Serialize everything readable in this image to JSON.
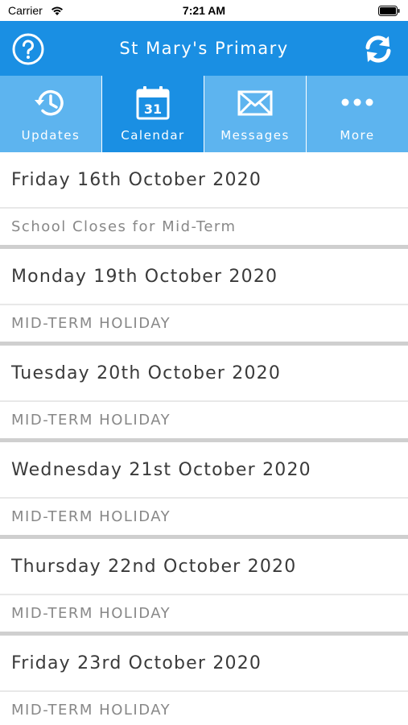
{
  "status_bar": {
    "carrier": "Carrier",
    "time": "7:21 AM"
  },
  "header": {
    "title": "St Mary's Primary",
    "help_icon": "question-circle-icon",
    "refresh_icon": "refresh-icon"
  },
  "colors": {
    "primary": "#1a8fe3",
    "tab_inactive": "#5db4ef",
    "divider": "#cfcfcf",
    "date_text": "#3a3a3a",
    "event_text": "#888888"
  },
  "tabs": [
    {
      "label": "Updates",
      "icon": "history-clock-icon",
      "active": false
    },
    {
      "label": "Calendar",
      "icon": "calendar-icon",
      "icon_text": "31",
      "active": true
    },
    {
      "label": "Messages",
      "icon": "envelope-icon",
      "active": false
    },
    {
      "label": "More",
      "icon": "ellipsis-icon",
      "active": false
    }
  ],
  "events": [
    {
      "date": "Friday 16th October 2020",
      "title": "School Closes for Mid-Term"
    },
    {
      "date": "Monday 19th October 2020",
      "title": "MID-TERM HOLIDAY"
    },
    {
      "date": "Tuesday 20th October 2020",
      "title": "MID-TERM HOLIDAY"
    },
    {
      "date": "Wednesday 21st October 2020",
      "title": "MID-TERM HOLIDAY"
    },
    {
      "date": "Thursday 22nd October 2020",
      "title": "MID-TERM HOLIDAY"
    },
    {
      "date": "Friday 23rd October 2020",
      "title": "MID-TERM HOLIDAY"
    }
  ]
}
